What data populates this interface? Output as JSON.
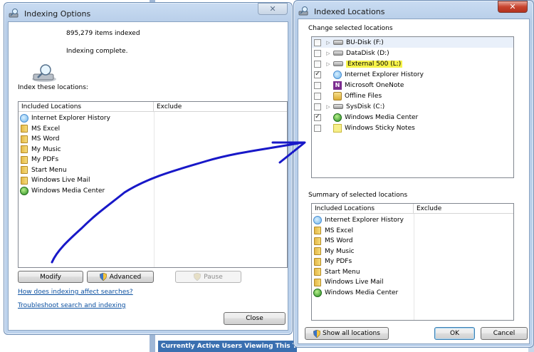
{
  "background": {
    "bottom_bar": "Currently Active Users Viewing This Thre"
  },
  "indexing_options": {
    "title": "Indexing Options",
    "items_indexed": "895,279 items indexed",
    "status": "Indexing complete.",
    "index_locations_label": "Index these locations:",
    "columns": [
      "Included Locations",
      "Exclude"
    ],
    "locations": [
      {
        "name": "Internet Explorer History",
        "icon": "ie-icon"
      },
      {
        "name": "MS Excel",
        "icon": "folder-icon"
      },
      {
        "name": "MS Word",
        "icon": "folder-icon"
      },
      {
        "name": "My Music",
        "icon": "folder-icon"
      },
      {
        "name": "My PDFs",
        "icon": "folder-icon"
      },
      {
        "name": "Start Menu",
        "icon": "folder-icon"
      },
      {
        "name": "Windows Live Mail",
        "icon": "folder-icon"
      },
      {
        "name": "Windows Media Center",
        "icon": "media-center-icon"
      }
    ],
    "buttons": {
      "modify": "Modify",
      "advanced": "Advanced",
      "pause": "Pause",
      "close": "Close"
    },
    "links": {
      "how_indexing": "How does indexing affect searches?",
      "troubleshoot": "Troubleshoot search and indexing"
    }
  },
  "indexed_locations": {
    "title": "Indexed Locations",
    "change_label": "Change selected locations",
    "tree": [
      {
        "name": "BU-Disk (F:)",
        "checked": false,
        "expandable": true,
        "icon": "drive-icon",
        "highlight": false
      },
      {
        "name": "DataDisk (D:)",
        "checked": false,
        "expandable": true,
        "icon": "drive-icon",
        "highlight": false
      },
      {
        "name": "External 500 (L:)",
        "checked": false,
        "expandable": true,
        "icon": "drive-icon",
        "highlight": true
      },
      {
        "name": "Internet Explorer History",
        "checked": true,
        "expandable": false,
        "icon": "ie-icon",
        "highlight": false
      },
      {
        "name": "Microsoft OneNote",
        "checked": false,
        "expandable": false,
        "icon": "onenote-icon",
        "highlight": false
      },
      {
        "name": "Offline Files",
        "checked": false,
        "expandable": false,
        "icon": "offline-files-icon",
        "highlight": false
      },
      {
        "name": "SysDisk (C:)",
        "checked": false,
        "expandable": true,
        "icon": "drive-icon",
        "highlight": false
      },
      {
        "name": "Windows Media Center",
        "checked": true,
        "expandable": false,
        "icon": "media-center-icon",
        "highlight": false
      },
      {
        "name": "Windows Sticky Notes",
        "checked": false,
        "expandable": false,
        "icon": "sticky-notes-icon",
        "highlight": false
      }
    ],
    "summary_label": "Summary of selected locations",
    "columns": [
      "Included Locations",
      "Exclude"
    ],
    "summary": [
      {
        "name": "Internet Explorer History",
        "icon": "ie-icon"
      },
      {
        "name": "MS Excel",
        "icon": "folder-icon"
      },
      {
        "name": "MS Word",
        "icon": "folder-icon"
      },
      {
        "name": "My Music",
        "icon": "folder-icon"
      },
      {
        "name": "My PDFs",
        "icon": "folder-icon"
      },
      {
        "name": "Start Menu",
        "icon": "folder-icon"
      },
      {
        "name": "Windows Live Mail",
        "icon": "folder-icon"
      },
      {
        "name": "Windows Media Center",
        "icon": "media-center-icon"
      }
    ],
    "buttons": {
      "show_all": "Show all locations",
      "ok": "OK",
      "cancel": "Cancel"
    }
  },
  "annotation": {
    "color": "#1818c8"
  }
}
